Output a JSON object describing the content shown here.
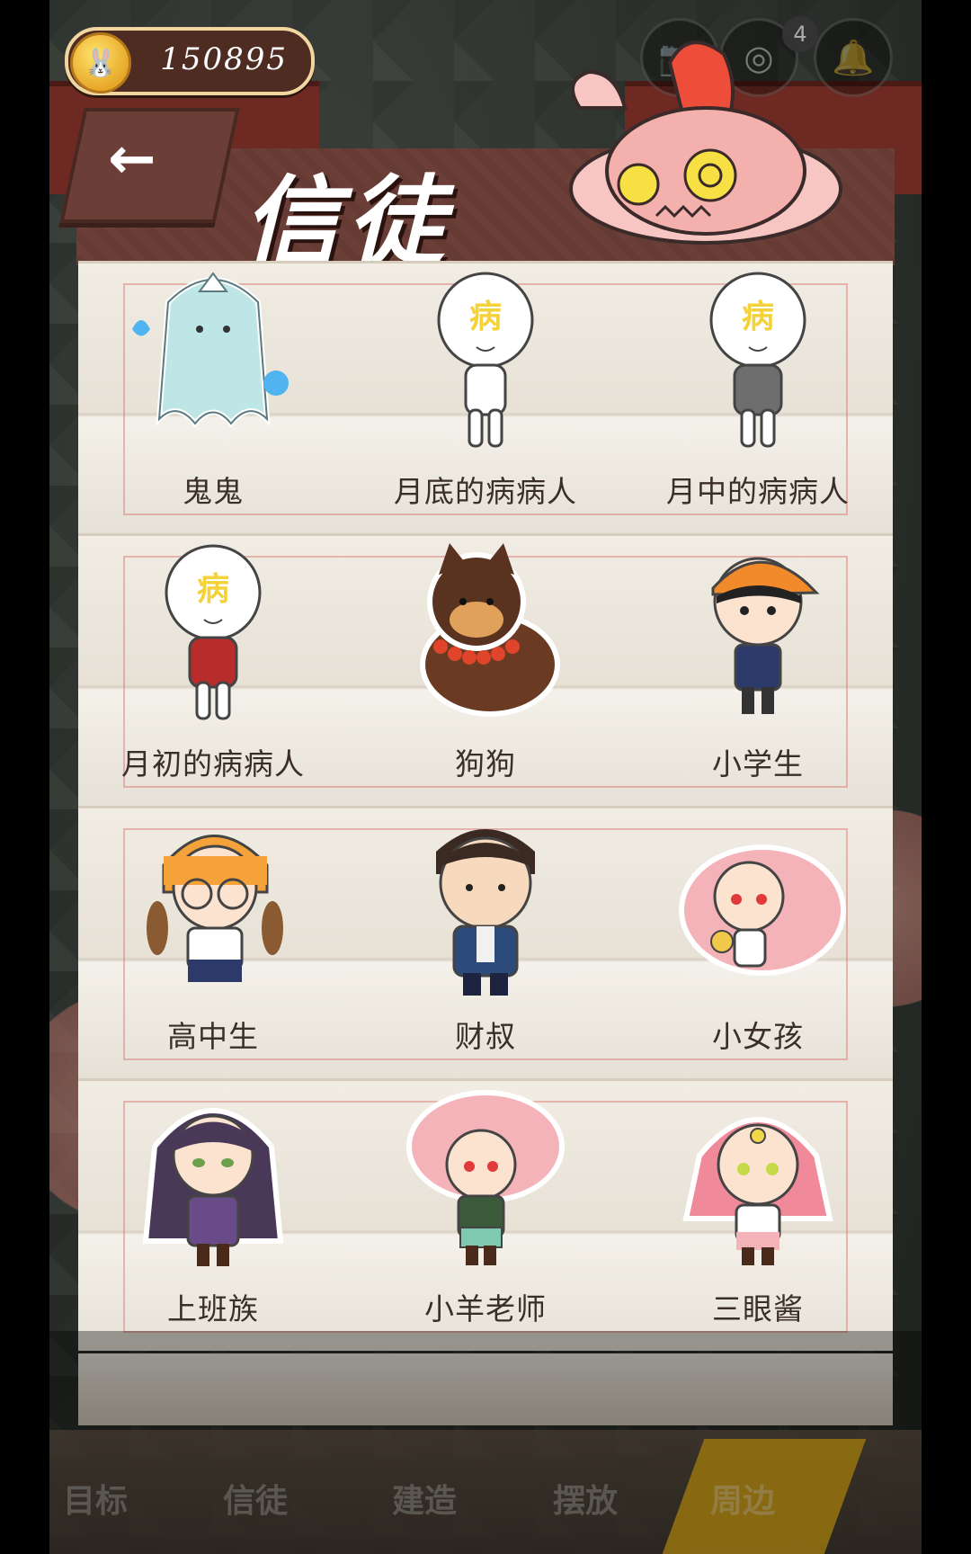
{
  "currency": {
    "value": "150895",
    "icon": "carrot-coin-icon"
  },
  "top_icons": {
    "camera": "camera-icon",
    "photo": "photo-icon",
    "bell": "bell-icon",
    "badge_count": "4"
  },
  "header": {
    "back_label": "←",
    "title": "信徒"
  },
  "followers": [
    {
      "name": "鬼鬼"
    },
    {
      "name": "月底的病病人"
    },
    {
      "name": "月中的病病人"
    },
    {
      "name": "月初的病病人"
    },
    {
      "name": "狗狗"
    },
    {
      "name": "小学生"
    },
    {
      "name": "高中生"
    },
    {
      "name": "财叔"
    },
    {
      "name": "小女孩"
    },
    {
      "name": "上班族"
    },
    {
      "name": "小羊老师"
    },
    {
      "name": "三眼酱"
    }
  ],
  "sick_mark": "病",
  "bottom_nav": [
    "目标",
    "信徒",
    "建造",
    "摆放",
    "周边"
  ],
  "colors": {
    "header": "#6b3f37",
    "shelf": "#efebe2",
    "coin": "#e7a82a",
    "ribbon": "#e9b319"
  }
}
